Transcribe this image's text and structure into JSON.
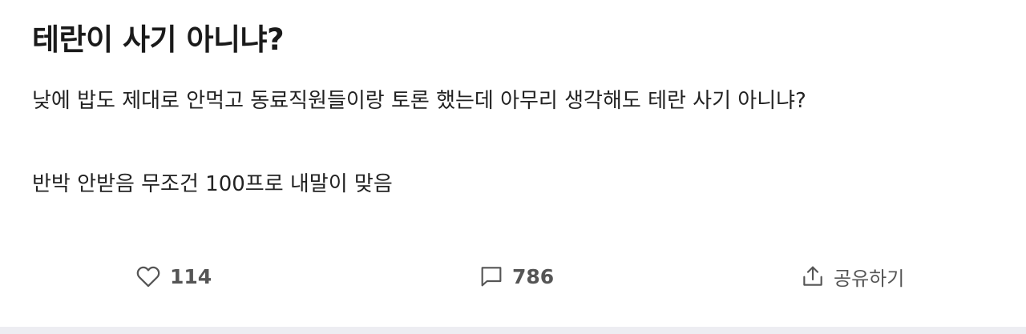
{
  "post": {
    "title": "테란이 사기 아니냐?",
    "body": [
      "낮에 밥도 제대로 안먹고 동료직원들이랑 토론 했는데 아무리 생각해도 테란 사기 아니냐?",
      "반박 안받음 무조건 100프로 내말이 맞음"
    ]
  },
  "actions": {
    "like": {
      "icon": "heart-icon",
      "count": "114"
    },
    "comment": {
      "icon": "comment-icon",
      "count": "786"
    },
    "share": {
      "icon": "share-icon",
      "label": "공유하기"
    }
  },
  "colors": {
    "text": "#1a1a1a",
    "muted": "#555555",
    "band": "#ededf2"
  }
}
